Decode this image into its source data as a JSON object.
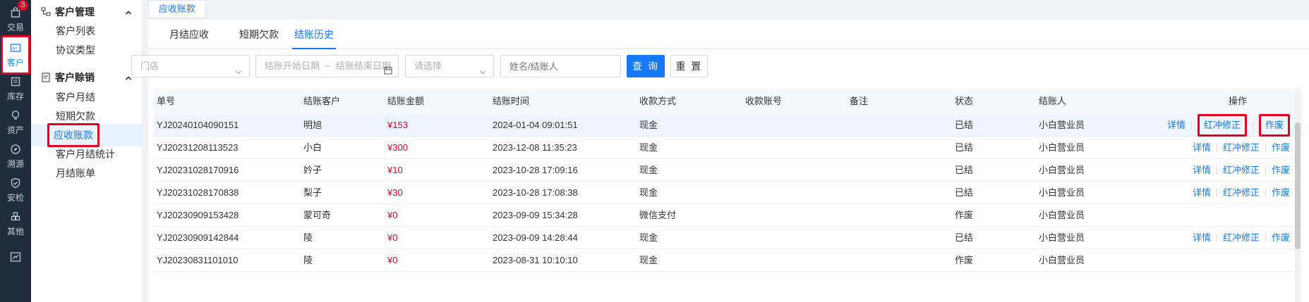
{
  "rail": {
    "items": [
      {
        "label": "交易",
        "icon": "bag-icon",
        "badge": "3"
      },
      {
        "label": "客户",
        "icon": "customer-card-icon",
        "active": true
      },
      {
        "label": "库存",
        "icon": "inventory-icon"
      },
      {
        "label": "资产",
        "icon": "bulb-icon"
      },
      {
        "label": "溯源",
        "icon": "compass-icon"
      },
      {
        "label": "安检",
        "icon": "shield-check-icon"
      },
      {
        "label": "其他",
        "icon": "grid-icon"
      }
    ]
  },
  "subnav": {
    "groups": [
      {
        "title": "客户管理",
        "items": [
          "客户列表",
          "协议类型"
        ]
      },
      {
        "title": "客户赊销",
        "items": [
          "客户月结",
          "短期欠款",
          "应收账款",
          "客户月结统计",
          "月结账单"
        ]
      }
    ]
  },
  "page_tab": "应收账款",
  "tabs": [
    "月结应收",
    "短期欠款",
    "结账历史"
  ],
  "filters": {
    "store_placeholder": "门店",
    "start_date_placeholder": "结账开始日期",
    "range_sep": "~",
    "end_date_placeholder": "结账结束日期",
    "select_placeholder": "请选择",
    "name_placeholder": "姓名/结账人",
    "search_label": "查 询",
    "reset_label": "重 置"
  },
  "table": {
    "headers": [
      "单号",
      "结账客户",
      "结账金额",
      "结账时间",
      "收款方式",
      "收款账号",
      "备注",
      "状态",
      "结账人",
      "操作"
    ],
    "rows": [
      {
        "id": "YJ20240104090151",
        "customer": "明旭",
        "amount": "¥153",
        "time": "2024-01-04 09:01:51",
        "method": "现金",
        "account": "",
        "note": "",
        "status": "已结",
        "operator": "小白营业员",
        "ops": [
          "详情",
          "红冲修正",
          "作废"
        ]
      },
      {
        "id": "YJ20231208113523",
        "customer": "小白",
        "amount": "¥300",
        "time": "2023-12-08 11:35:23",
        "method": "现金",
        "account": "",
        "note": "",
        "status": "已结",
        "operator": "小白营业员",
        "ops": [
          "详情",
          "红冲修正",
          "作废"
        ]
      },
      {
        "id": "YJ20231028170916",
        "customer": "妗子",
        "amount": "¥10",
        "time": "2023-10-28 17:09:16",
        "method": "现金",
        "account": "",
        "note": "",
        "status": "已结",
        "operator": "小白营业员",
        "ops": [
          "详情",
          "红冲修正",
          "作废"
        ]
      },
      {
        "id": "YJ20231028170838",
        "customer": "梨子",
        "amount": "¥30",
        "time": "2023-10-28 17:08:38",
        "method": "现金",
        "account": "",
        "note": "",
        "status": "已结",
        "operator": "小白营业员",
        "ops": [
          "详情",
          "红冲修正",
          "作废"
        ]
      },
      {
        "id": "YJ20230909153428",
        "customer": "蒙可奇",
        "amount": "¥0",
        "time": "2023-09-09 15:34:28",
        "method": "微信支付",
        "account": "",
        "note": "",
        "status": "作废",
        "operator": "小白营业员",
        "ops": []
      },
      {
        "id": "YJ20230909142844",
        "customer": "陵",
        "amount": "¥0",
        "time": "2023-09-09 14:28:44",
        "method": "现金",
        "account": "",
        "note": "",
        "status": "已结",
        "operator": "小白营业员",
        "ops": [
          "详情",
          "红冲修正",
          "作废"
        ]
      },
      {
        "id": "YJ20230831101010",
        "customer": "陵",
        "amount": "¥0",
        "time": "2023-08-31 10:10:10",
        "method": "现金",
        "account": "",
        "note": "",
        "status": "作废",
        "operator": "小白营业员",
        "ops": []
      }
    ]
  },
  "colors": {
    "accent": "#1677ff",
    "highlight": "#e6001f",
    "rail": "#1f2d3d"
  }
}
